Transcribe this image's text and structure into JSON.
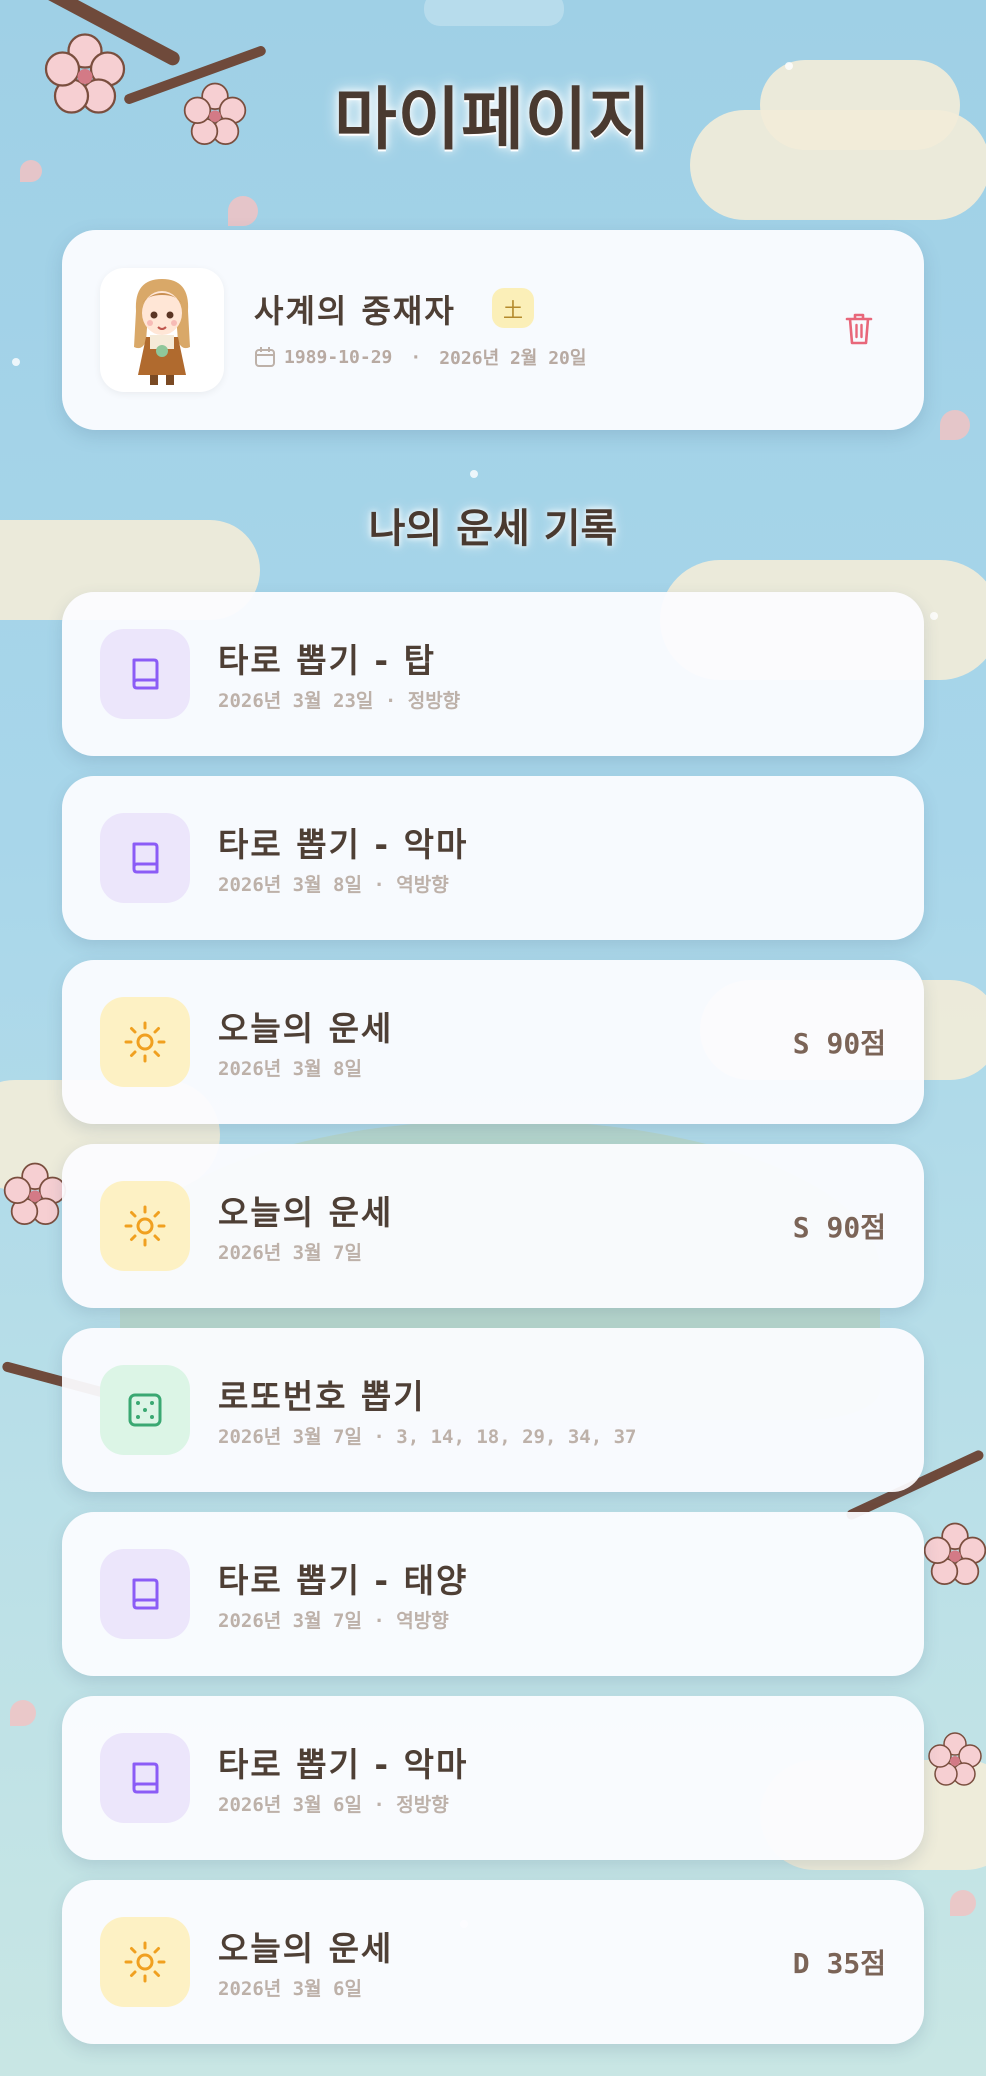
{
  "page": {
    "title": "마이페이지"
  },
  "profile": {
    "name": "사계의 중재자",
    "element": "土",
    "birth": "1989-10-29",
    "separator": "·",
    "date": "2026년 2월 20일"
  },
  "history": {
    "title": "나의 운세 기록",
    "records": [
      {
        "kind": "tarot",
        "title": "타로 뽑기 - 탑",
        "sub": "2026년 3월 23일 · 정방향",
        "score": ""
      },
      {
        "kind": "tarot",
        "title": "타로 뽑기 - 악마",
        "sub": "2026년 3월 8일 · 역방향",
        "score": ""
      },
      {
        "kind": "daily",
        "title": "오늘의 운세",
        "sub": "2026년 3월 8일",
        "score": "S 90점"
      },
      {
        "kind": "daily",
        "title": "오늘의 운세",
        "sub": "2026년 3월 7일",
        "score": "S 90점"
      },
      {
        "kind": "lotto",
        "title": "로또번호 뽑기",
        "sub": "2026년 3월 7일 · 3, 14, 18, 29, 34, 37",
        "score": ""
      },
      {
        "kind": "tarot",
        "title": "타로 뽑기 - 태양",
        "sub": "2026년 3월 7일 · 역방향",
        "score": ""
      },
      {
        "kind": "tarot",
        "title": "타로 뽑기 - 악마",
        "sub": "2026년 3월 6일 · 정방향",
        "score": ""
      },
      {
        "kind": "daily",
        "title": "오늘의 운세",
        "sub": "2026년 3월 6일",
        "score": "D 35점"
      }
    ]
  },
  "colors": {
    "tarot_bg": "#ece6fb",
    "tarot_fg": "#8b5cf6",
    "daily_bg": "#fdf1c4",
    "daily_fg": "#f0a020",
    "lotto_bg": "#dcf5e6",
    "lotto_fg": "#3aa872",
    "delete": "#e8677a"
  },
  "icons": {
    "tarot": "book-icon",
    "daily": "sun-icon",
    "lotto": "dice-icon",
    "delete": "trash-icon",
    "calendar": "calendar-icon"
  }
}
